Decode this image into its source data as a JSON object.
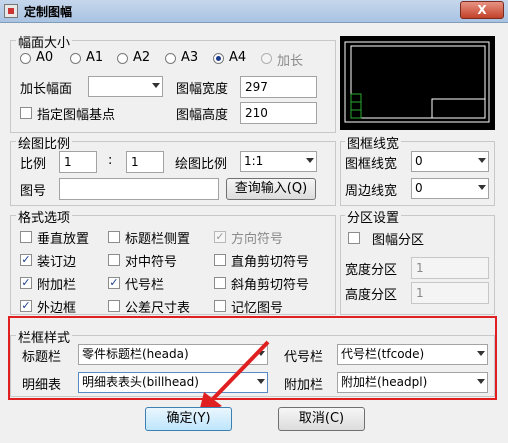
{
  "window": {
    "title": "定制图幅",
    "close": "X"
  },
  "paper_size": {
    "legend": "幅面大小",
    "sizes": [
      "A0",
      "A1",
      "A2",
      "A3",
      "A4",
      "加长"
    ],
    "selected": "A4",
    "extended_label": "加长幅面",
    "extended_value": "",
    "base_point_label": "指定图幅基点",
    "width_label": "图幅宽度",
    "width_value": "297",
    "height_label": "图幅高度",
    "height_value": "210"
  },
  "scale": {
    "legend": "绘图比例",
    "ratio_label": "比例",
    "ratio_left": "1",
    "colon": ":",
    "ratio_right": "1",
    "drawing_scale_label": "绘图比例",
    "drawing_scale_value": "1:1",
    "drawing_no_label": "图号",
    "drawing_no_value": "",
    "query_button": "查询输入(Q)"
  },
  "frame_line_width": {
    "legend": "图框线宽",
    "frame_label": "图框线宽",
    "frame_value": "0",
    "border_label": "周边线宽",
    "border_value": "0"
  },
  "format_options": {
    "legend": "格式选项",
    "items": [
      {
        "label": "垂直放置",
        "checked": false,
        "disabled": false
      },
      {
        "label": "标题栏侧置",
        "checked": false,
        "disabled": false
      },
      {
        "label": "方向符号",
        "checked": true,
        "disabled": true
      },
      {
        "label": "装订边",
        "checked": true,
        "disabled": false
      },
      {
        "label": "对中符号",
        "checked": false,
        "disabled": false
      },
      {
        "label": "直角剪切符号",
        "checked": false,
        "disabled": false
      },
      {
        "label": "附加栏",
        "checked": true,
        "disabled": false
      },
      {
        "label": "代号栏",
        "checked": true,
        "disabled": false
      },
      {
        "label": "斜角剪切符号",
        "checked": false,
        "disabled": false
      },
      {
        "label": "外边框",
        "checked": true,
        "disabled": false
      },
      {
        "label": "公差尺寸表",
        "checked": false,
        "disabled": false
      },
      {
        "label": "记忆图号",
        "checked": false,
        "disabled": false
      }
    ]
  },
  "zones": {
    "legend": "分区设置",
    "zone_label": "图幅分区",
    "width_label": "宽度分区",
    "width_value": "1",
    "height_label": "高度分区",
    "height_value": "1"
  },
  "frame_style": {
    "legend": "栏框样式",
    "title_bar_label": "标题栏",
    "title_bar_value": "零件标题栏(heada)",
    "code_bar_label": "代号栏",
    "code_bar_value": "代号栏(tfcode)",
    "detail_label": "明细表",
    "detail_value": "明细表表头(billhead)",
    "extra_label": "附加栏",
    "extra_value": "附加栏(headpl)"
  },
  "buttons": {
    "ok": "确定(Y)",
    "cancel": "取消(C)"
  },
  "colors": {
    "highlight": "#e02020",
    "accent": "#1a3a8a"
  }
}
